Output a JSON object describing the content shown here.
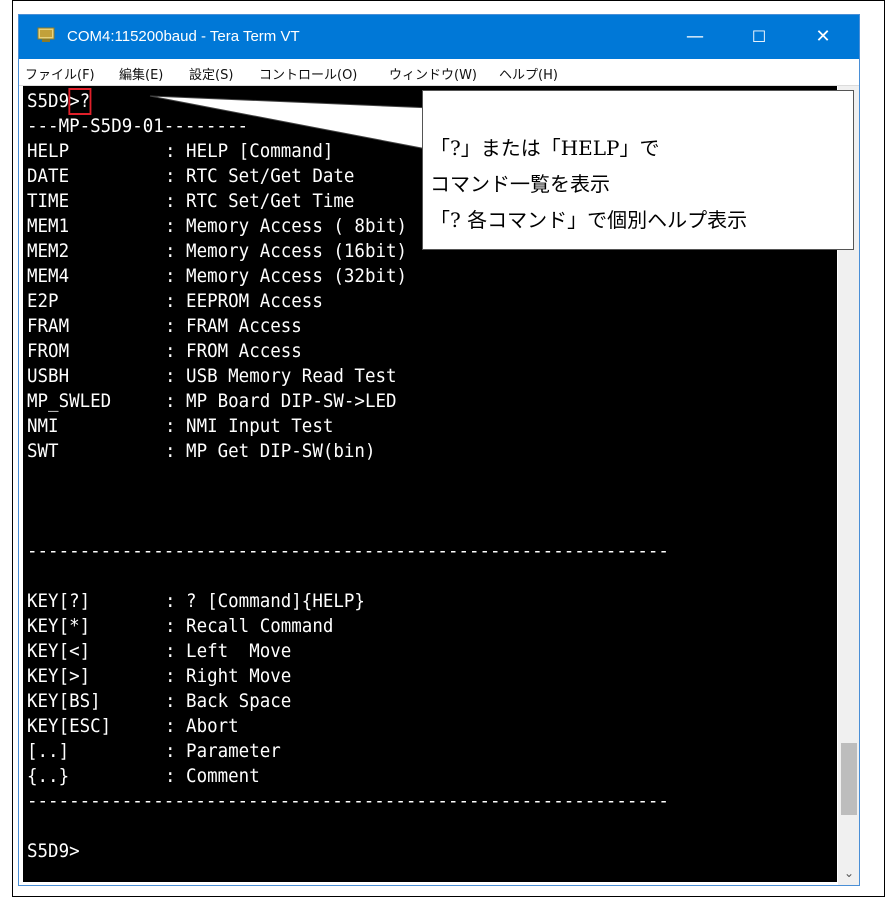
{
  "window": {
    "title": "COM4:115200baud - Tera Term VT",
    "minimize": "—",
    "maximize": "☐",
    "close": "✕"
  },
  "menu": [
    "ファイル(F)",
    "編集(E)",
    "設定(S)",
    "コントロール(O)",
    "ウィンドウ(W)",
    "ヘルプ(H)"
  ],
  "terminal": {
    "prompt_line": {
      "prompt": "S5D9",
      "input": ">?"
    },
    "header": "---MP-S5D9-01--------",
    "commands": [
      {
        "cmd": "HELP",
        "desc": ": HELP [Command]"
      },
      {
        "cmd": "DATE",
        "desc": ": RTC Set/Get Date"
      },
      {
        "cmd": "TIME",
        "desc": ": RTC Set/Get Time"
      },
      {
        "cmd": "MEM1",
        "desc": ": Memory Access ( 8bit)"
      },
      {
        "cmd": "MEM2",
        "desc": ": Memory Access (16bit)"
      },
      {
        "cmd": "MEM4",
        "desc": ": Memory Access (32bit)"
      },
      {
        "cmd": "E2P",
        "desc": ": EEPROM Access"
      },
      {
        "cmd": "FRAM",
        "desc": ": FRAM Access"
      },
      {
        "cmd": "FROM",
        "desc": ": FROM Access"
      },
      {
        "cmd": "USBH",
        "desc": ": USB Memory Read Test"
      },
      {
        "cmd": "MP_SWLED",
        "desc": ": MP Board DIP-SW->LED"
      },
      {
        "cmd": "NMI",
        "desc": ": NMI Input Test"
      },
      {
        "cmd": "SWT",
        "desc": ": MP Get DIP-SW(bin)"
      }
    ],
    "divider": "-------------------------------------------------------------",
    "keys": [
      {
        "cmd": "KEY[?]",
        "desc": ": ? [Command]{HELP}"
      },
      {
        "cmd": "KEY[*]",
        "desc": ": Recall Command"
      },
      {
        "cmd": "KEY[<]",
        "desc": ": Left  Move"
      },
      {
        "cmd": "KEY[>]",
        "desc": ": Right Move"
      },
      {
        "cmd": "KEY[BS]",
        "desc": ": Back Space"
      },
      {
        "cmd": "KEY[ESC]",
        "desc": ": Abort"
      },
      {
        "cmd": "[..]",
        "desc": ": Parameter"
      },
      {
        "cmd": "{..}",
        "desc": ": Comment"
      }
    ],
    "final_prompt": "S5D9>"
  },
  "callout": {
    "line1": "「?」または「HELP」で",
    "line2": "コマンド一覧を表示",
    "line3": "「? 各コマンド」で個別ヘルプ表示"
  },
  "colors": {
    "titlebar": "#0078d7",
    "terminal_bg": "#000000",
    "terminal_fg": "#ffffff",
    "highlight": "#e0202a"
  }
}
